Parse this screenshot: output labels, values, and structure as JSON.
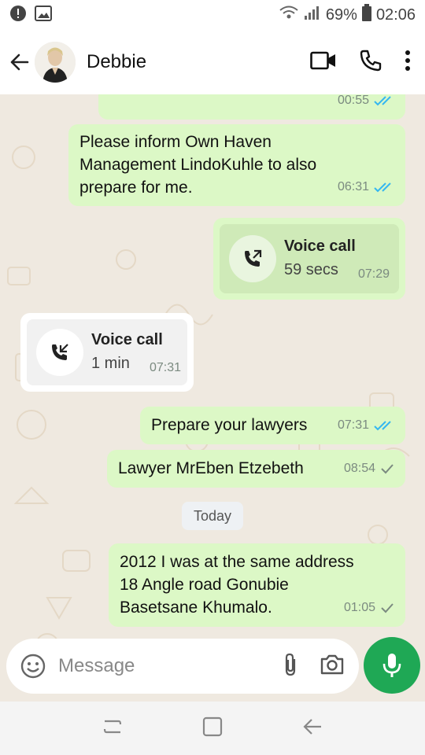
{
  "status": {
    "battery": "69%",
    "time": "02:06"
  },
  "contact": {
    "name": "Debbie"
  },
  "messages": [
    {
      "type": "text",
      "text": "",
      "time": "00:55",
      "ticks": "read"
    },
    {
      "type": "text",
      "lines": [
        "Please inform Own Haven",
        "Management LindoKuhle to also",
        "prepare for me."
      ],
      "time": "06:31",
      "ticks": "read"
    },
    {
      "type": "call",
      "title": "Voice call",
      "duration": "59 secs",
      "time": "07:29",
      "direction": "outgoing"
    },
    {
      "type": "call",
      "title": "Voice call",
      "duration": "1 min",
      "time": "07:31",
      "direction": "incoming"
    },
    {
      "type": "text",
      "lines": [
        "Prepare your lawyers"
      ],
      "time": "07:31",
      "ticks": "read"
    },
    {
      "type": "text",
      "lines": [
        "Lawyer MrEben Etzebeth"
      ],
      "time": "08:54",
      "ticks": "sent"
    },
    {
      "type": "text",
      "lines": [
        "2012 I was at the same address",
        "18 Angle road Gonubie",
        "Basetsane Khumalo."
      ],
      "time": "01:05",
      "ticks": "sent"
    }
  ],
  "date_chip": "Today",
  "input": {
    "placeholder": "Message"
  },
  "colors": {
    "outgoing_bubble": "#dcf8c6",
    "read_tick": "#34b7f1",
    "mic_button": "#1fa855"
  }
}
